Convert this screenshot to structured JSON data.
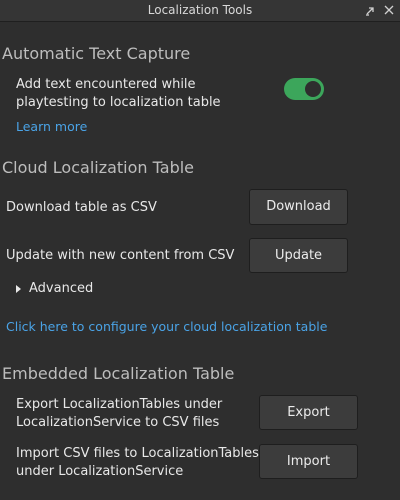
{
  "window": {
    "title": "Localization Tools",
    "dock_icon": "undock-icon",
    "close_icon": "close-icon"
  },
  "auto_capture": {
    "header": "Automatic Text Capture",
    "label_line1": "Add text encountered while",
    "label_line2": "playtesting to localization table",
    "toggle_on": true,
    "toggle_color": "#3ca65b",
    "learn_more": "Learn more"
  },
  "cloud": {
    "header": "Cloud Localization Table",
    "download_label": "Download table as CSV",
    "download_button": "Download",
    "update_label": "Update with new content from CSV",
    "update_button": "Update",
    "advanced_label": "Advanced",
    "configure_link": "Click here to configure your cloud localization table"
  },
  "embedded": {
    "header": "Embedded Localization Table",
    "export_label_line1": "Export LocalizationTables under",
    "export_label_line2": "LocalizationService to CSV files",
    "export_button": "Export",
    "import_label_line1": "Import CSV files to LocalizationTables",
    "import_label_line2": "under LocalizationService",
    "import_button": "Import"
  },
  "colors": {
    "background": "#2e2e2e",
    "link": "#4aa3e6",
    "button": "#3c3c3c"
  }
}
